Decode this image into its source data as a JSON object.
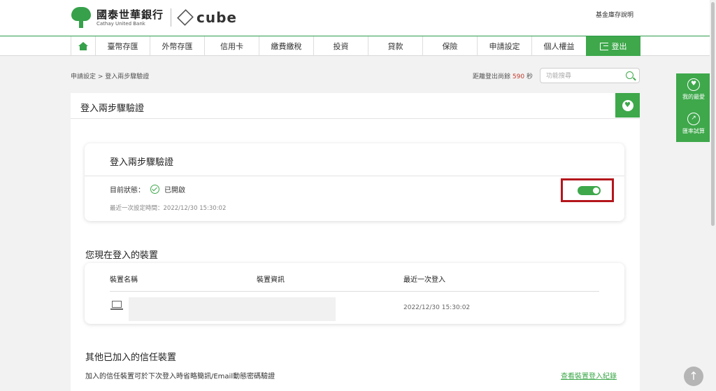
{
  "header": {
    "bank_name_zh": "國泰世華銀行",
    "bank_name_en": "Cathay United Bank",
    "cube_brand": "cube",
    "fund_link": "基金庫存說明"
  },
  "nav": {
    "items": [
      "臺幣存匯",
      "外幣存匯",
      "信用卡",
      "繳費繳稅",
      "投資",
      "貸款",
      "保險",
      "申請設定",
      "個人權益"
    ],
    "logout": "登出"
  },
  "breadcrumb": "申請設定 > 登入兩步驟驗證",
  "session": {
    "prefix": "距離登出尚餘",
    "seconds": "590",
    "unit": "秒"
  },
  "search": {
    "placeholder": "功能搜尋"
  },
  "panel": {
    "title": "登入兩步驟驗證"
  },
  "two_step": {
    "title": "登入兩步驟驗證",
    "status_label": "目前狀態：",
    "status_value": "已開啟",
    "last_set": "最近一次設定時間：2022/12/30 15:30:02",
    "enabled": true
  },
  "current_devices": {
    "title": "您現在登入的裝置",
    "columns": [
      "裝置名稱",
      "裝置資訊",
      "最近一次登入"
    ],
    "rows": [
      {
        "last_login": "2022/12/30 15:30:02"
      }
    ]
  },
  "trusted_devices": {
    "title": "其他已加入的信任裝置",
    "description": "加入的信任裝置可於下次登入時省略簡訊/Email動態密碼驗證",
    "link": "查看裝置登入紀錄"
  },
  "side_tools": [
    {
      "label": "我的最愛",
      "icon": "heart-icon"
    },
    {
      "label": "匯率試算",
      "icon": "trend-chart-icon"
    }
  ],
  "colors": {
    "brand_green": "#3ea84b",
    "highlight_red": "#b4161c",
    "countdown_red": "#c0392b"
  }
}
